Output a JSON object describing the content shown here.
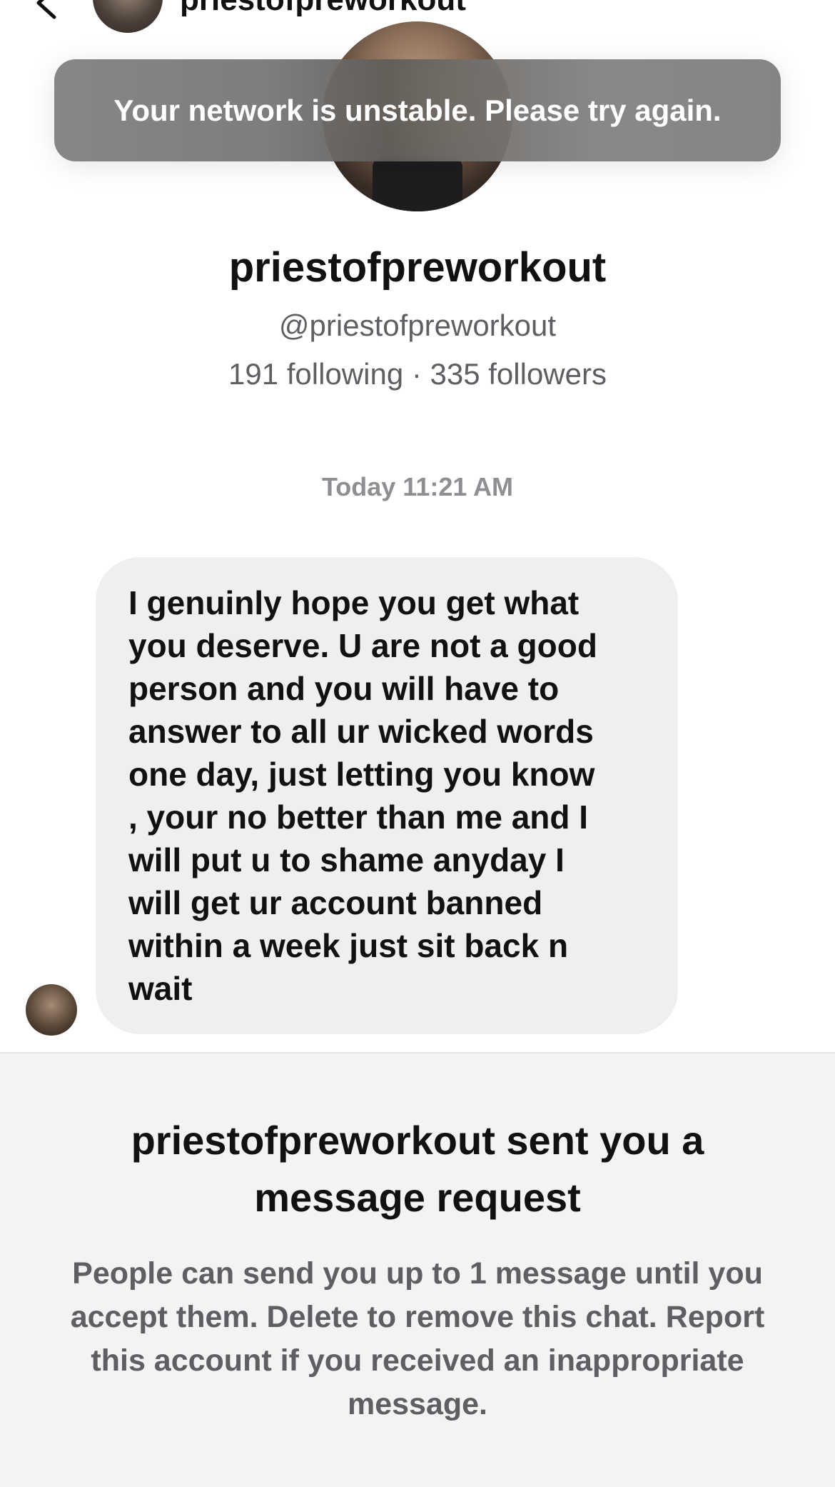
{
  "nav": {
    "username": "priestofpreworkout"
  },
  "toast": {
    "message": "Your network is unstable. Please try again."
  },
  "profile": {
    "display_name": "priestofpreworkout",
    "handle": "@priestofpreworkout",
    "stats": "191 following · 335 followers"
  },
  "chat": {
    "timestamp": "Today 11:21 AM",
    "message": "I genuinly hope you get what\nyou deserve. U are not a good\nperson and you will have to\nanswer to all ur wicked words\none day, just letting you know\n, your no better than me and I\nwill put u to shame anyday I\nwill get ur account banned\nwithin a week just sit back n\nwait"
  },
  "request": {
    "title": "priestofpreworkout sent you a message request",
    "body": "People can send you up to 1 message until you accept them. Delete to remove this chat. Report this account if you received an inappropriate message."
  },
  "icons": {
    "back": "chevron-left-icon",
    "more": "more-dots-icon"
  }
}
